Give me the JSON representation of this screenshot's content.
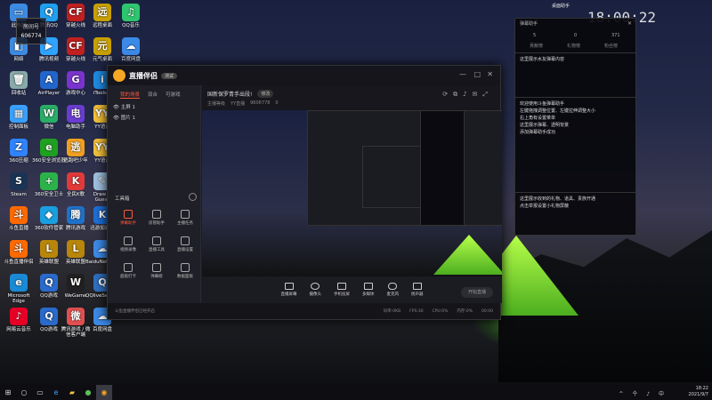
{
  "desktop": {
    "icons": [
      {
        "label": "此电脑",
        "icon": "pc-icon",
        "color": "#3d8be0",
        "glyph": "▭"
      },
      {
        "label": "网络",
        "icon": "network-icon",
        "color": "#3d8be0",
        "glyph": "◧"
      },
      {
        "label": "回收站",
        "icon": "recycle-bin-icon",
        "color": "#8aa",
        "glyph": "🗑"
      },
      {
        "label": "控制面板",
        "icon": "control-panel-icon",
        "color": "#3aa0ff",
        "glyph": "▦"
      },
      {
        "label": "360压缩",
        "icon": "zip-icon",
        "color": "#2f83ff",
        "glyph": "Z"
      },
      {
        "label": "Steam",
        "icon": "steam-icon",
        "color": "#1b3355",
        "glyph": "S"
      },
      {
        "label": "斗鱼直播",
        "icon": "douyu-icon",
        "color": "#ff6a00",
        "glyph": "斗"
      },
      {
        "label": "斗鱼直播伴侣",
        "icon": "douyu-partner-icon",
        "color": "#ff6a00",
        "glyph": "斗"
      },
      {
        "label": "Microsoft Edge",
        "icon": "edge-icon",
        "color": "#1a8ad4",
        "glyph": "e"
      },
      {
        "label": "网易云音乐",
        "icon": "netease-music-icon",
        "color": "#e60026",
        "glyph": "♪"
      },
      {
        "label": "腾讯QQ",
        "icon": "qq-icon",
        "color": "#1fa0f0",
        "glyph": "Q"
      },
      {
        "label": "腾讯视频",
        "icon": "tencent-video-icon",
        "color": "#2fa3ff",
        "glyph": "▶"
      },
      {
        "label": "AirPlayer",
        "icon": "airplayer-icon",
        "color": "#2266cc",
        "glyph": "A"
      },
      {
        "label": "微信",
        "icon": "wechat-icon",
        "color": "#2aae67",
        "glyph": "W"
      },
      {
        "label": "360安全浏览器",
        "icon": "360-browser-icon",
        "color": "#20a020",
        "glyph": "e"
      },
      {
        "label": "360安全卫士",
        "icon": "360-guard-icon",
        "color": "#2bb34a",
        "glyph": "+"
      },
      {
        "label": "360软件管家",
        "icon": "360-software-icon",
        "color": "#1a9fe0",
        "glyph": "◆"
      },
      {
        "label": "英雄联盟",
        "icon": "lol-icon",
        "color": "#b8860b",
        "glyph": "L"
      },
      {
        "label": "QQ游戏",
        "icon": "qq-game-icon",
        "color": "#2a6acb",
        "glyph": "Q"
      },
      {
        "label": "QQ游戏",
        "icon": "qq-game2-icon",
        "color": "#2a6acb",
        "glyph": "Q"
      },
      {
        "label": "穿越火线",
        "icon": "cf-icon",
        "color": "#c02020",
        "glyph": "CF"
      },
      {
        "label": "穿越火线",
        "icon": "cf2-icon",
        "color": "#c02020",
        "glyph": "CF"
      },
      {
        "label": "游戏中心",
        "icon": "game-center-icon",
        "color": "#7a33cc",
        "glyph": "G"
      },
      {
        "label": "电脑助手",
        "icon": "pc-assist-icon",
        "color": "#6a3cd0",
        "glyph": "电"
      },
      {
        "label": "逃跑吧少年",
        "icon": "escape-icon",
        "color": "#f0a020",
        "glyph": "逃"
      },
      {
        "label": "全民K歌",
        "icon": "kge-icon",
        "color": "#e03a3a",
        "glyph": "K"
      },
      {
        "label": "腾讯游戏",
        "icon": "tx-game-icon",
        "color": "#1f72c9",
        "glyph": "腾"
      },
      {
        "label": "英雄联盟",
        "icon": "lol2-icon",
        "color": "#b8860b",
        "glyph": "L"
      },
      {
        "label": "WeGame",
        "icon": "wegame-icon",
        "color": "#202020",
        "glyph": "W"
      },
      {
        "label": "腾讯游戏 / 微信客户端",
        "icon": "wx-client-icon",
        "color": "#e05050",
        "glyph": "微"
      },
      {
        "label": "远程桌面",
        "icon": "remote-icon",
        "color": "#c8a000",
        "glyph": "远"
      },
      {
        "label": "元气桌面",
        "icon": "yuanqi-icon",
        "color": "#c8a000",
        "glyph": "元"
      },
      {
        "label": "iTools 4",
        "icon": "itools-icon",
        "color": "#1f8ae0",
        "glyph": "i"
      },
      {
        "label": "YY语音",
        "icon": "yy-icon",
        "color": "#f3c03a",
        "glyph": "YY"
      },
      {
        "label": "YY语音",
        "icon": "yy2-icon",
        "color": "#f3c03a",
        "glyph": "YY"
      },
      {
        "label": "Draw & Guess",
        "icon": "draw-guess-icon",
        "color": "#a0c0e0",
        "glyph": "✎"
      },
      {
        "label": "迅游加速器",
        "icon": "xunyou-icon",
        "color": "#1d6fd8",
        "glyph": "K"
      },
      {
        "label": "BaiduNetdisk_bojmj...",
        "icon": "baidu-netdisk-icon",
        "color": "#3c8ae8",
        "glyph": "☁"
      },
      {
        "label": "QQliveSetup_20_758",
        "icon": "qqlive-setup-icon",
        "color": "#2f6fc0",
        "glyph": "Q"
      },
      {
        "label": "百度网盘",
        "icon": "baidu-pan-icon",
        "color": "#3c8ae8",
        "glyph": "☁"
      },
      {
        "label": "QQ音乐",
        "icon": "qq-music-icon",
        "color": "#2fc56e",
        "glyph": "♫"
      },
      {
        "label": "百度网盘",
        "icon": "baidu-pan2-icon",
        "color": "#3c8ae8",
        "glyph": "☁"
      }
    ],
    "room_badge": "房间号",
    "room_number": "606774"
  },
  "app": {
    "name": "直播伴侣",
    "badge": "测试",
    "window_controls": [
      "—",
      "□",
      "✕"
    ],
    "sidebar_tabs": [
      "我的场景",
      "双合",
      "可游戏"
    ],
    "scenes": [
      "主屏 1",
      "图片 1"
    ],
    "tools_title": "工具箱",
    "tools": [
      {
        "label": "弹幕助手",
        "active": true
      },
      {
        "label": "房管助手",
        "active": false
      },
      {
        "label": "主播任务",
        "active": false
      },
      {
        "label": "视频录像",
        "active": false
      },
      {
        "label": "直播工具",
        "active": false
      },
      {
        "label": "直播设置",
        "active": false
      },
      {
        "label": "超级打卡",
        "active": false
      },
      {
        "label": "弹幕姬",
        "active": false
      },
      {
        "label": "数据面板",
        "active": false
      }
    ],
    "stage_title": "国新保罗青手出段!",
    "stage_pill": "修改",
    "stage_sub": [
      "主播等级",
      "YY直播",
      "9606778",
      "0"
    ],
    "bottom_buttons": [
      "直播屏幕",
      "摄像头",
      "手机投屏",
      "多媒体",
      "麦克风",
      "扬声器"
    ],
    "start_live": "开始直播",
    "status_items": [
      "斗鱼直播伴侣已经开启",
      "码率:0KB",
      "FPS:30",
      "CPU:0%",
      "内存:0%",
      "00:00"
    ]
  },
  "panel": {
    "title": "弹幕助手",
    "counts": [
      "5",
      "0",
      "371"
    ],
    "tabs": [
      "贡献榜",
      "礼物榜",
      "粉丝榜"
    ],
    "lines": [
      "这里展示水友弹幕内容",
      "欢迎使用斗鱼弹幕助手",
      "左键拖拽调整位置、左键拉伸调整大小",
      "右上角有设置菜单",
      "这里展示弹幕、透明背景",
      "添加弹幕助手成功"
    ],
    "gift_lines": [
      "这里展示收到的礼物、道具、贵族开通",
      "点击举报设置小礼物屏蔽"
    ]
  },
  "taskbar": {
    "time": "18:22",
    "date": "2021/9/7",
    "tray_icons": "^ 㐃 ♪ 中"
  },
  "top_clock": "18:00:22",
  "top_banner": "桌面助手"
}
